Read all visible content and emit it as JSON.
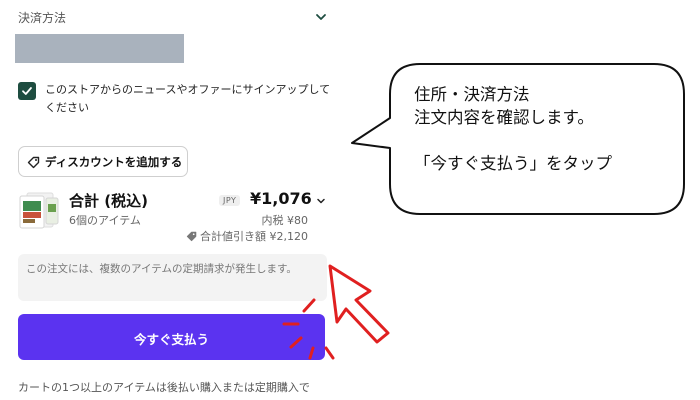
{
  "payment": {
    "header_label": "決済方法"
  },
  "newsletter": {
    "checked": true,
    "label": "このストアからのニュースやオファーにサインアップしてください"
  },
  "discount": {
    "label": "ディスカウントを追加する"
  },
  "summary": {
    "title": "合計 (税込)",
    "item_count": "6個のアイテム",
    "currency": "JPY",
    "total": "¥1,076",
    "tax": "内税 ¥80",
    "savings": "合計値引き額 ¥2,120"
  },
  "notice": {
    "text": "この注文には、複数のアイテムの定期請求が発生します。"
  },
  "pay_button": {
    "label": "今すぐ支払う"
  },
  "footer": {
    "text": "カートの1つ以上のアイテムは後払い購入または定期購入で"
  },
  "annotation": {
    "line1": "住所・決済方法",
    "line2": "注文内容を確認します。",
    "line3": "「今すぐ支払う」をタップ"
  },
  "colors": {
    "accent": "#5b33f0",
    "checkbox": "#1e4d40",
    "annotation_red": "#e02020"
  }
}
